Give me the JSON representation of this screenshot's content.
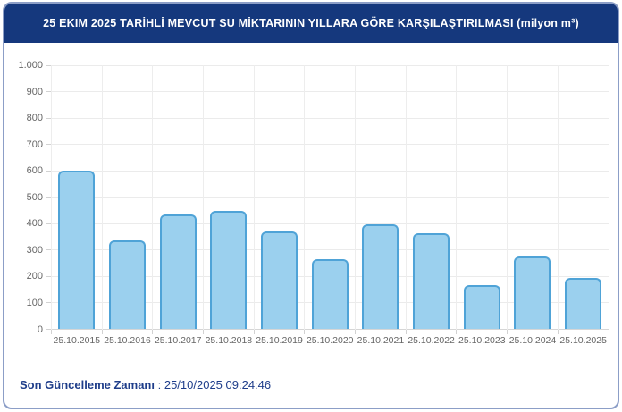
{
  "header": {
    "title": "25 EKIM 2025 TARİHLİ MEVCUT SU MİKTARININ YILLARA GÖRE KARŞILAŞTIRILMASI (milyon m³)"
  },
  "footer": {
    "label": "Son Güncelleme Zamanı",
    "separator": " : ",
    "value": "25/10/2025 09:24:46"
  },
  "colors": {
    "header_bg": "#15387d",
    "card_border": "#8c9ec7",
    "bar_fill": "#9bd0ee",
    "bar_border": "#4fa3d7",
    "grid": "#ebebeb",
    "axis_line": "#d6d6d6",
    "tick_text": "#666666",
    "footer_text": "#1e3d8a"
  },
  "chart_data": {
    "type": "bar",
    "title": "25 EKIM 2025 TARİHLİ MEVCUT SU MİKTARININ YILLARA GÖRE KARŞILAŞTIRILMASI (milyon m³)",
    "categories": [
      "25.10.2015",
      "25.10.2016",
      "25.10.2017",
      "25.10.2018",
      "25.10.2019",
      "25.10.2020",
      "25.10.2021",
      "25.10.2022",
      "25.10.2023",
      "25.10.2024",
      "25.10.2025"
    ],
    "values": [
      600,
      337,
      436,
      447,
      371,
      266,
      399,
      364,
      167,
      277,
      193
    ],
    "xlabel": "",
    "ylabel": "",
    "ylim": [
      0,
      1000
    ],
    "ytick_step": 100,
    "ytick_labels": [
      "0",
      "100",
      "200",
      "300",
      "400",
      "500",
      "600",
      "700",
      "800",
      "900",
      "1.000"
    ],
    "grid": true,
    "legend_position": "none"
  }
}
